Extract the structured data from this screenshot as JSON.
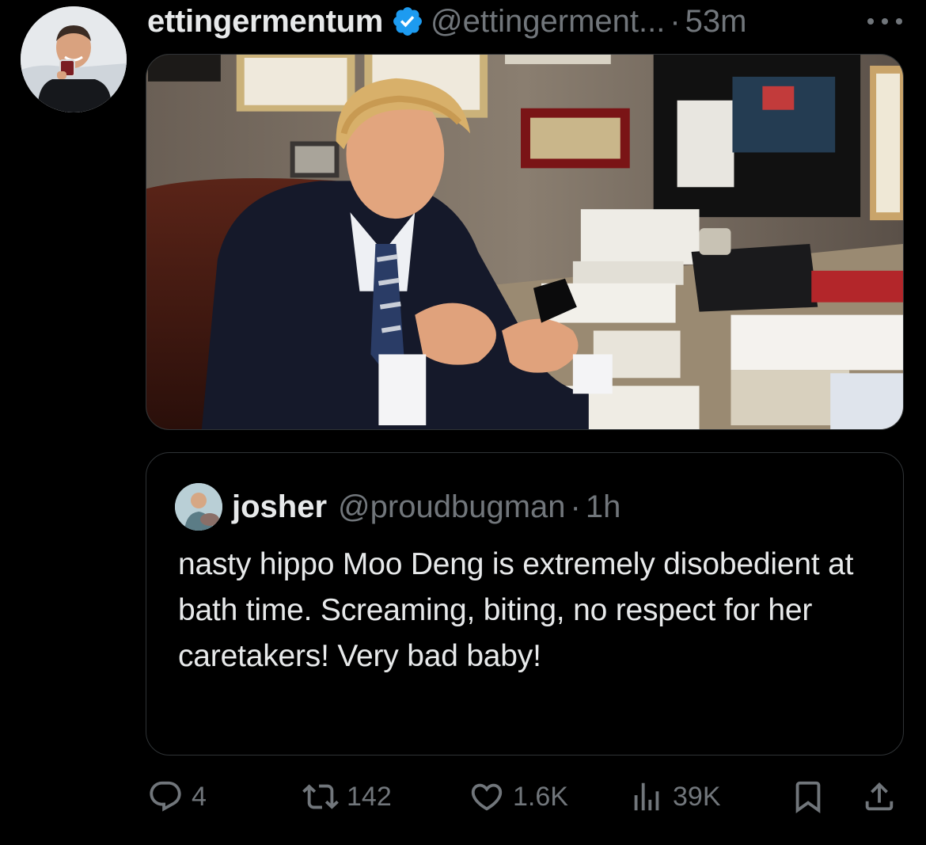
{
  "tweet": {
    "author": {
      "display_name": "ettingermentum",
      "handle": "@ettingerment...",
      "verified_icon": "verified-badge-icon"
    },
    "separator": "·",
    "time": "53m",
    "more_icon": "more-horizontal-icon",
    "media": {
      "kind": "photo"
    }
  },
  "quoted_tweet": {
    "author": {
      "display_name": "josher",
      "handle": "@proudbugman"
    },
    "separator": "·",
    "time": "1h",
    "text": "nasty hippo Moo Deng is extremely disobedient at bath time. Screaming, biting, no respect for her caretakers! Very bad baby!"
  },
  "actions": {
    "reply": {
      "icon": "reply-icon",
      "count": "4"
    },
    "retweet": {
      "icon": "retweet-icon",
      "count": "142"
    },
    "like": {
      "icon": "heart-icon",
      "count": "1.6K"
    },
    "views": {
      "icon": "views-chart-icon",
      "count": "39K"
    },
    "bookmark": {
      "icon": "bookmark-icon"
    },
    "share": {
      "icon": "share-icon"
    }
  },
  "colors": {
    "background": "#000000",
    "primary_text": "#e7e9ea",
    "secondary_text": "#71767b",
    "border": "#2f3336",
    "verified_blue": "#1d9bf0"
  }
}
